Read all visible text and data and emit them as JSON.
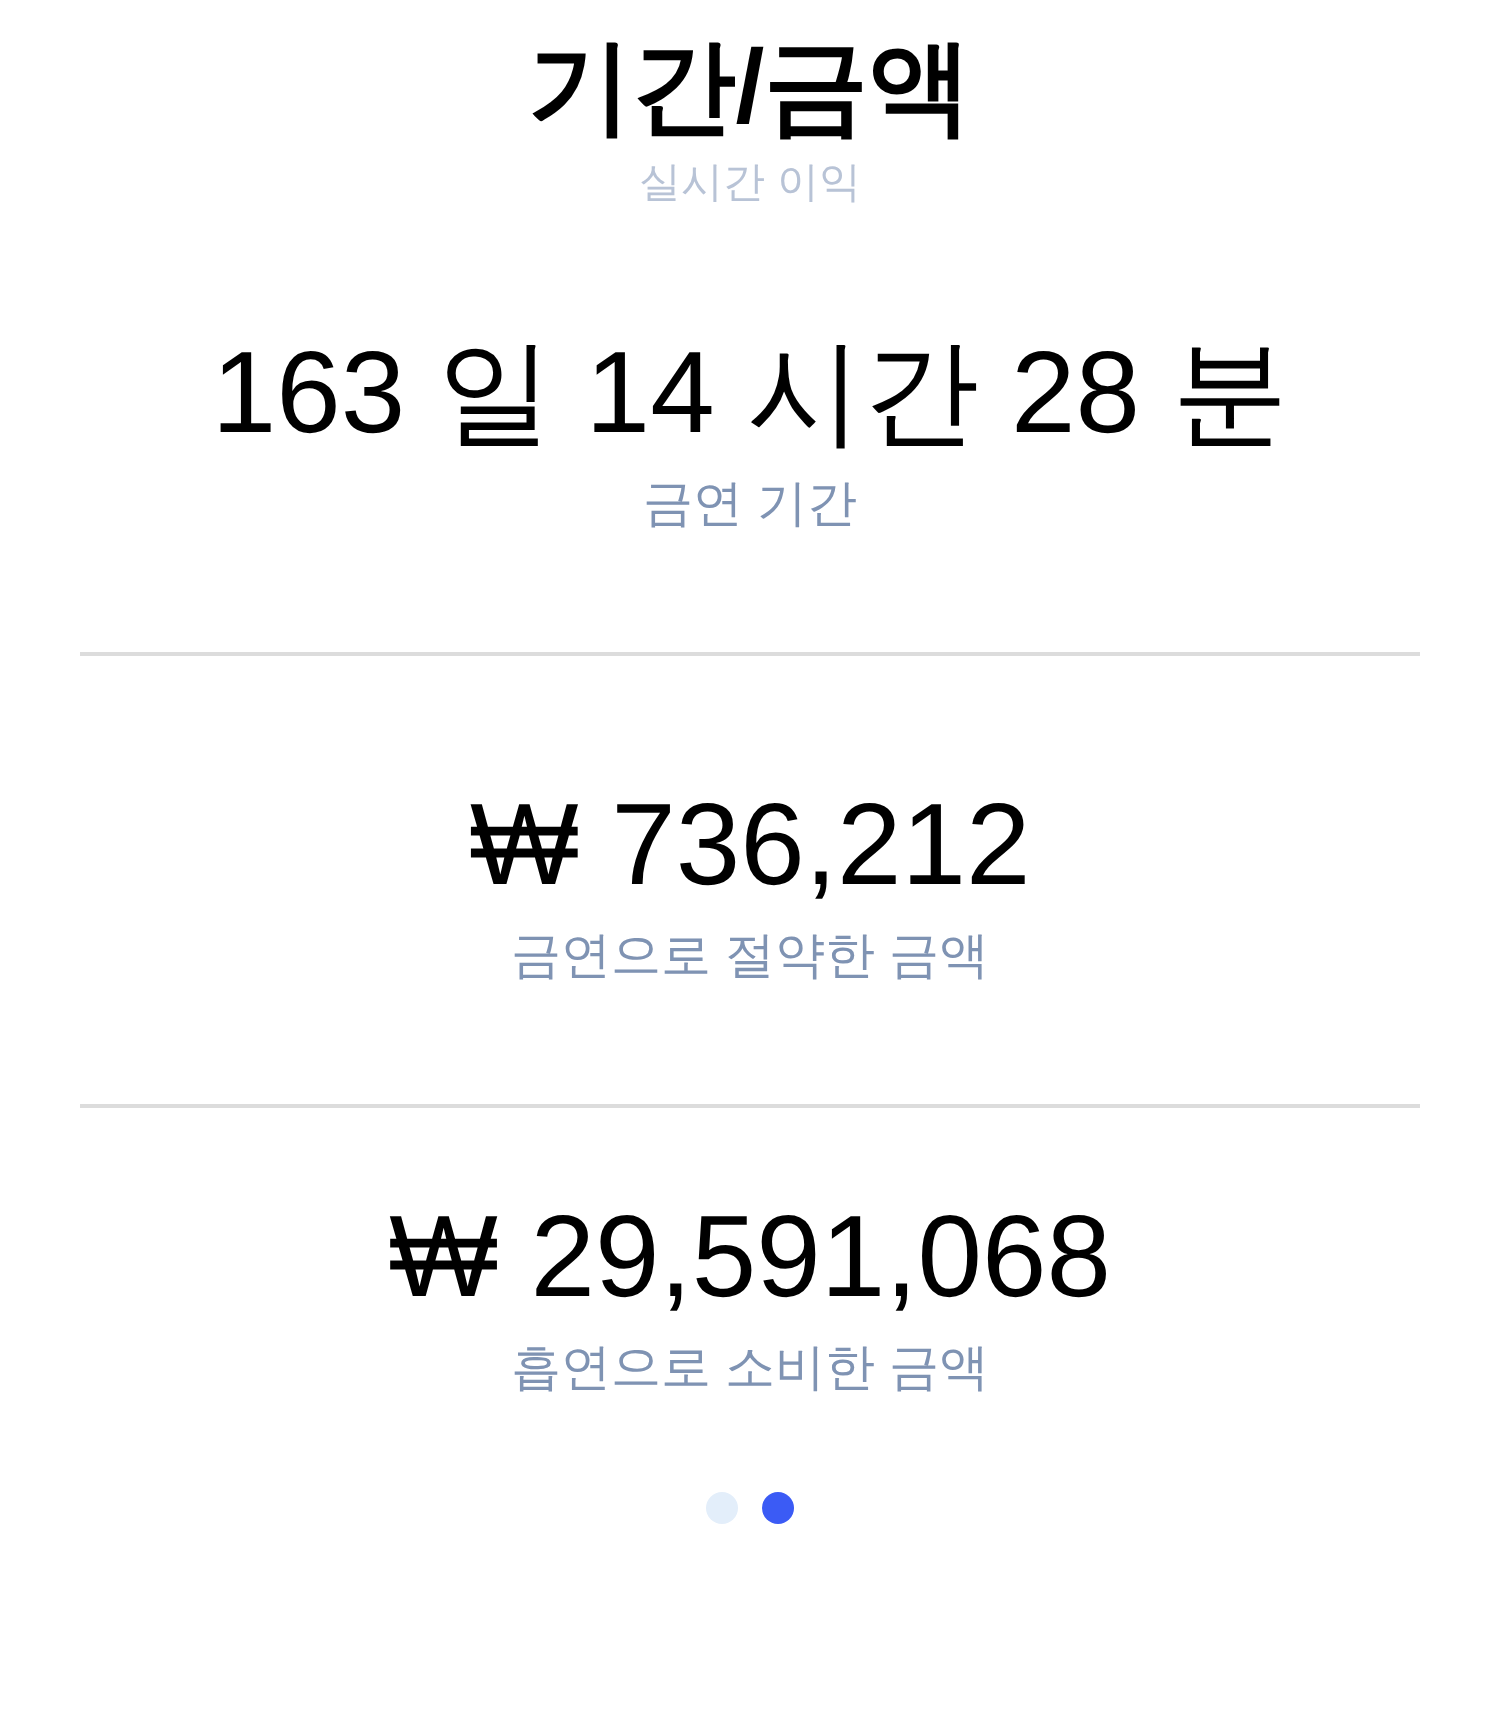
{
  "title": "기간/금액",
  "subtitle": "실시간 이익",
  "stats": [
    {
      "value": "163 일 14 시간 28 분",
      "label": "금연 기간"
    },
    {
      "value": "₩ 736,212",
      "label": "금연으로 절약한 금액"
    },
    {
      "value": "₩ 29,591,068",
      "label": "흡연으로 소비한 금액"
    }
  ],
  "page_indicator": [
    {
      "selected": false
    },
    {
      "selected": true
    }
  ]
}
